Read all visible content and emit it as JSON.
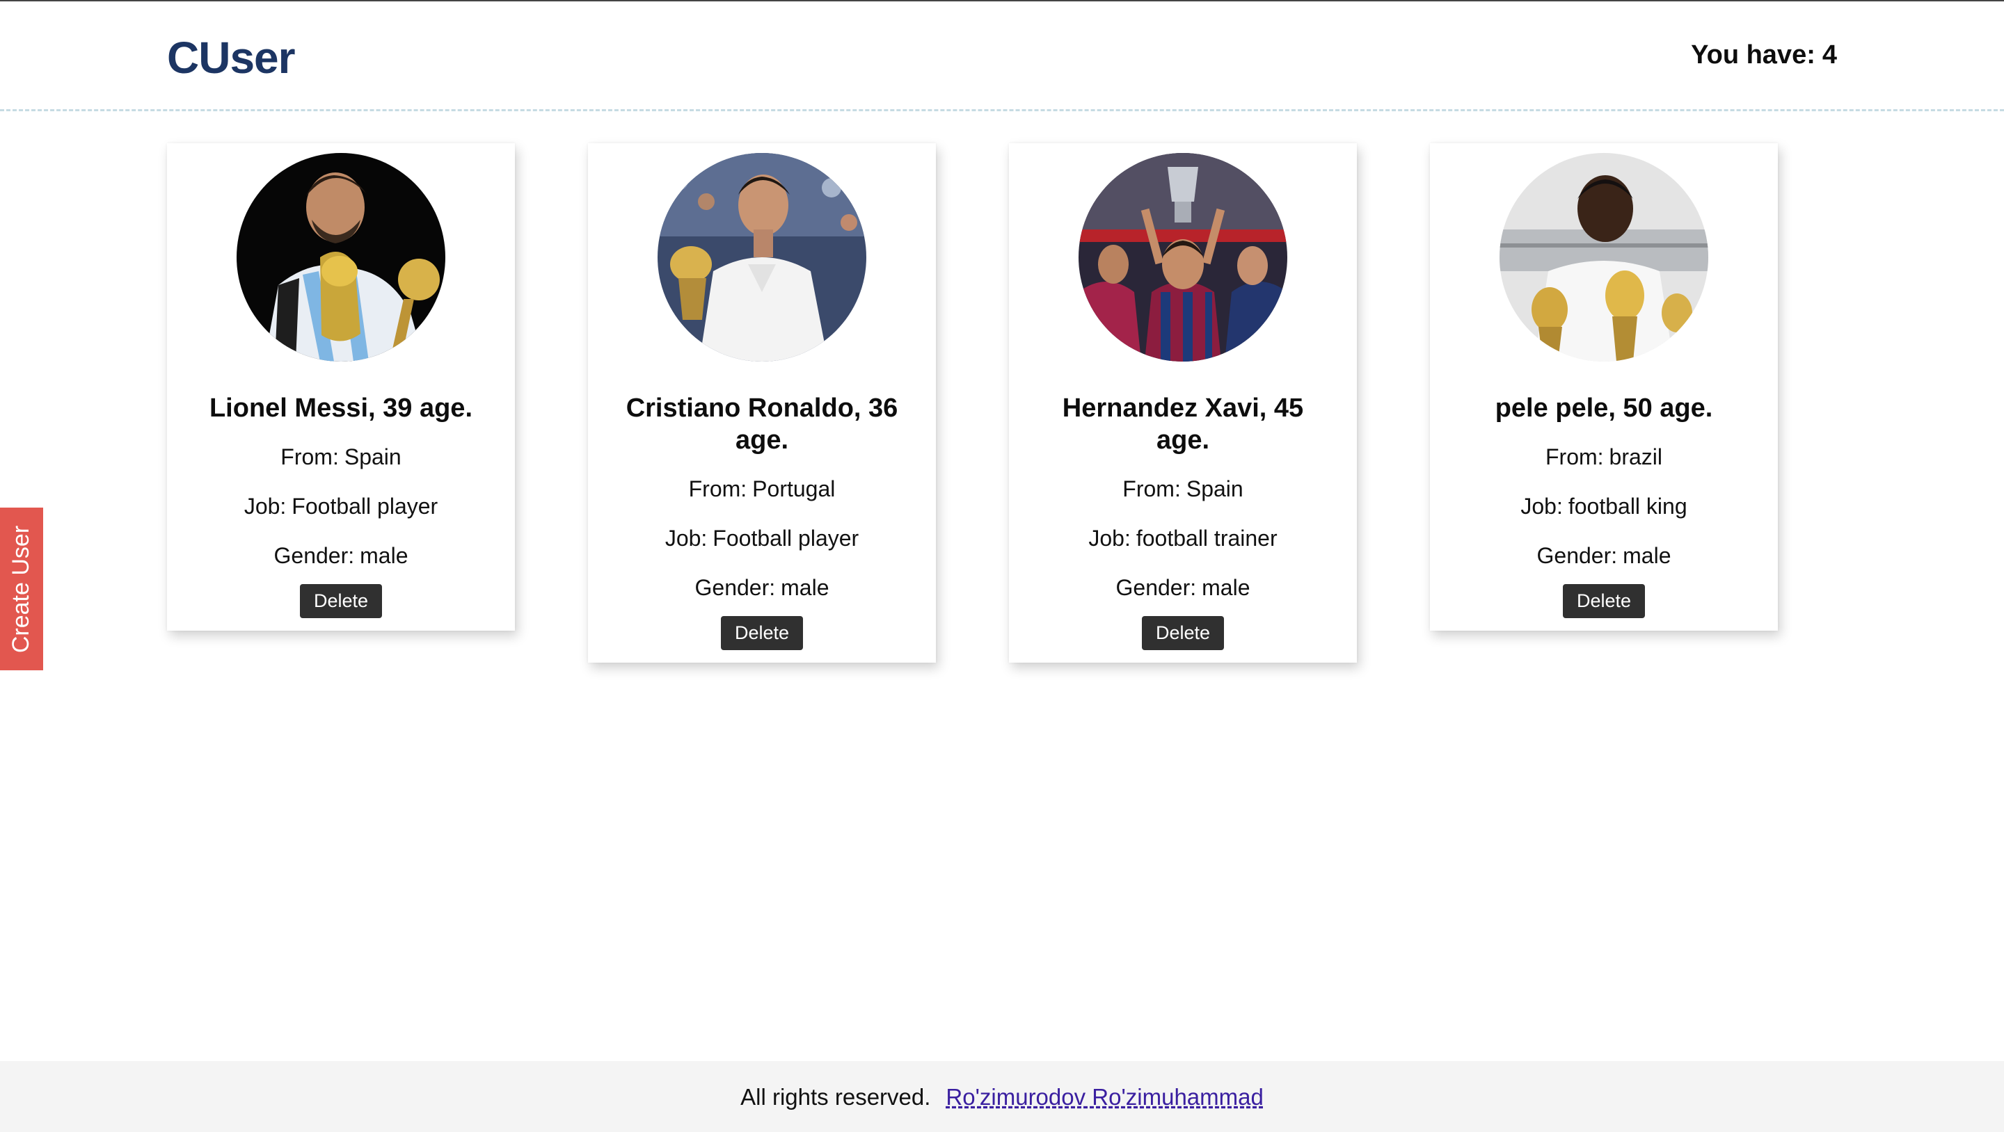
{
  "header": {
    "logo": "CUser",
    "count_label": "You have:",
    "count_value": "4"
  },
  "sidebar": {
    "create_label": "Create User"
  },
  "labels": {
    "from": "From:",
    "job": "Job:",
    "gender": "Gender:",
    "delete": "Delete"
  },
  "users": [
    {
      "name": "Lionel Messi, 39 age.",
      "from": "Spain",
      "job": "Football player",
      "gender": "male",
      "photo": "messi-photo"
    },
    {
      "name": "Cristiano Ronaldo, 36 age.",
      "from": "Portugal",
      "job": "Football player",
      "gender": "male",
      "photo": "ronaldo-photo"
    },
    {
      "name": "Hernandez Xavi, 45 age.",
      "from": "Spain",
      "job": "football trainer",
      "gender": "male",
      "photo": "xavi-photo"
    },
    {
      "name": "pele pele, 50 age.",
      "from": "brazil",
      "job": "football king",
      "gender": "male",
      "photo": "pele-photo"
    }
  ],
  "footer": {
    "text": "All rights reserved.",
    "author": "Ro'zimurodov Ro'zimuhammad"
  },
  "colors": {
    "brand": "#1c3563",
    "create_tab": "#e2574f",
    "delete_button": "#303030",
    "footer_bg": "#f4f4f4",
    "link": "#3a1fa0"
  }
}
